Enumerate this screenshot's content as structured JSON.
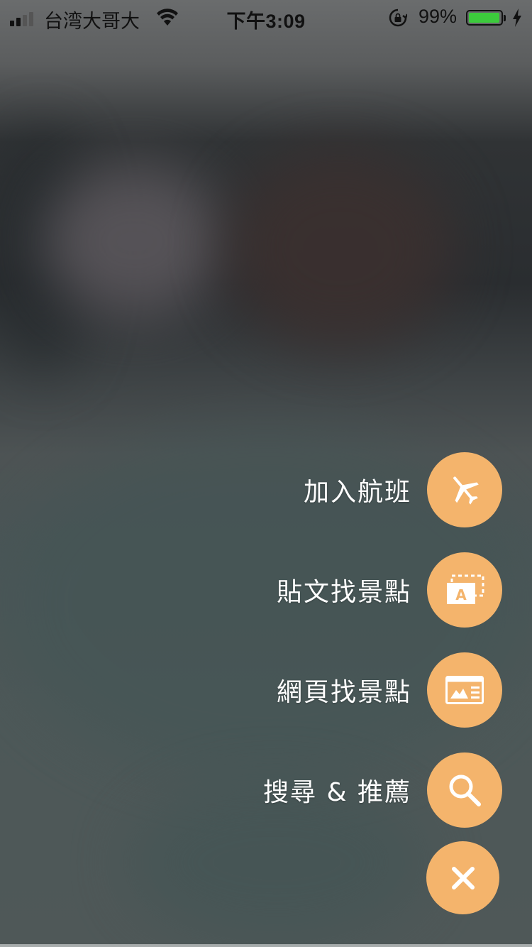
{
  "status_bar": {
    "carrier": "台湾大哥大",
    "time": "下午3:09",
    "battery_percent": "99%",
    "battery_level": 0.99,
    "signal_bars_active": 2,
    "signal_bars_total": 4
  },
  "menu": {
    "items": [
      {
        "label": "加入航班",
        "icon": "airplane-icon"
      },
      {
        "label": "貼文找景點",
        "icon": "text-document-icon"
      },
      {
        "label": "網頁找景點",
        "icon": "webpage-image-icon"
      },
      {
        "label": "搜尋 & 推薦",
        "icon": "search-icon"
      }
    ],
    "close_icon": "close-icon"
  },
  "colors": {
    "fab_color": "#f4b46c",
    "battery_fill": "#3ccb3c",
    "label_color": "#ffffff"
  }
}
